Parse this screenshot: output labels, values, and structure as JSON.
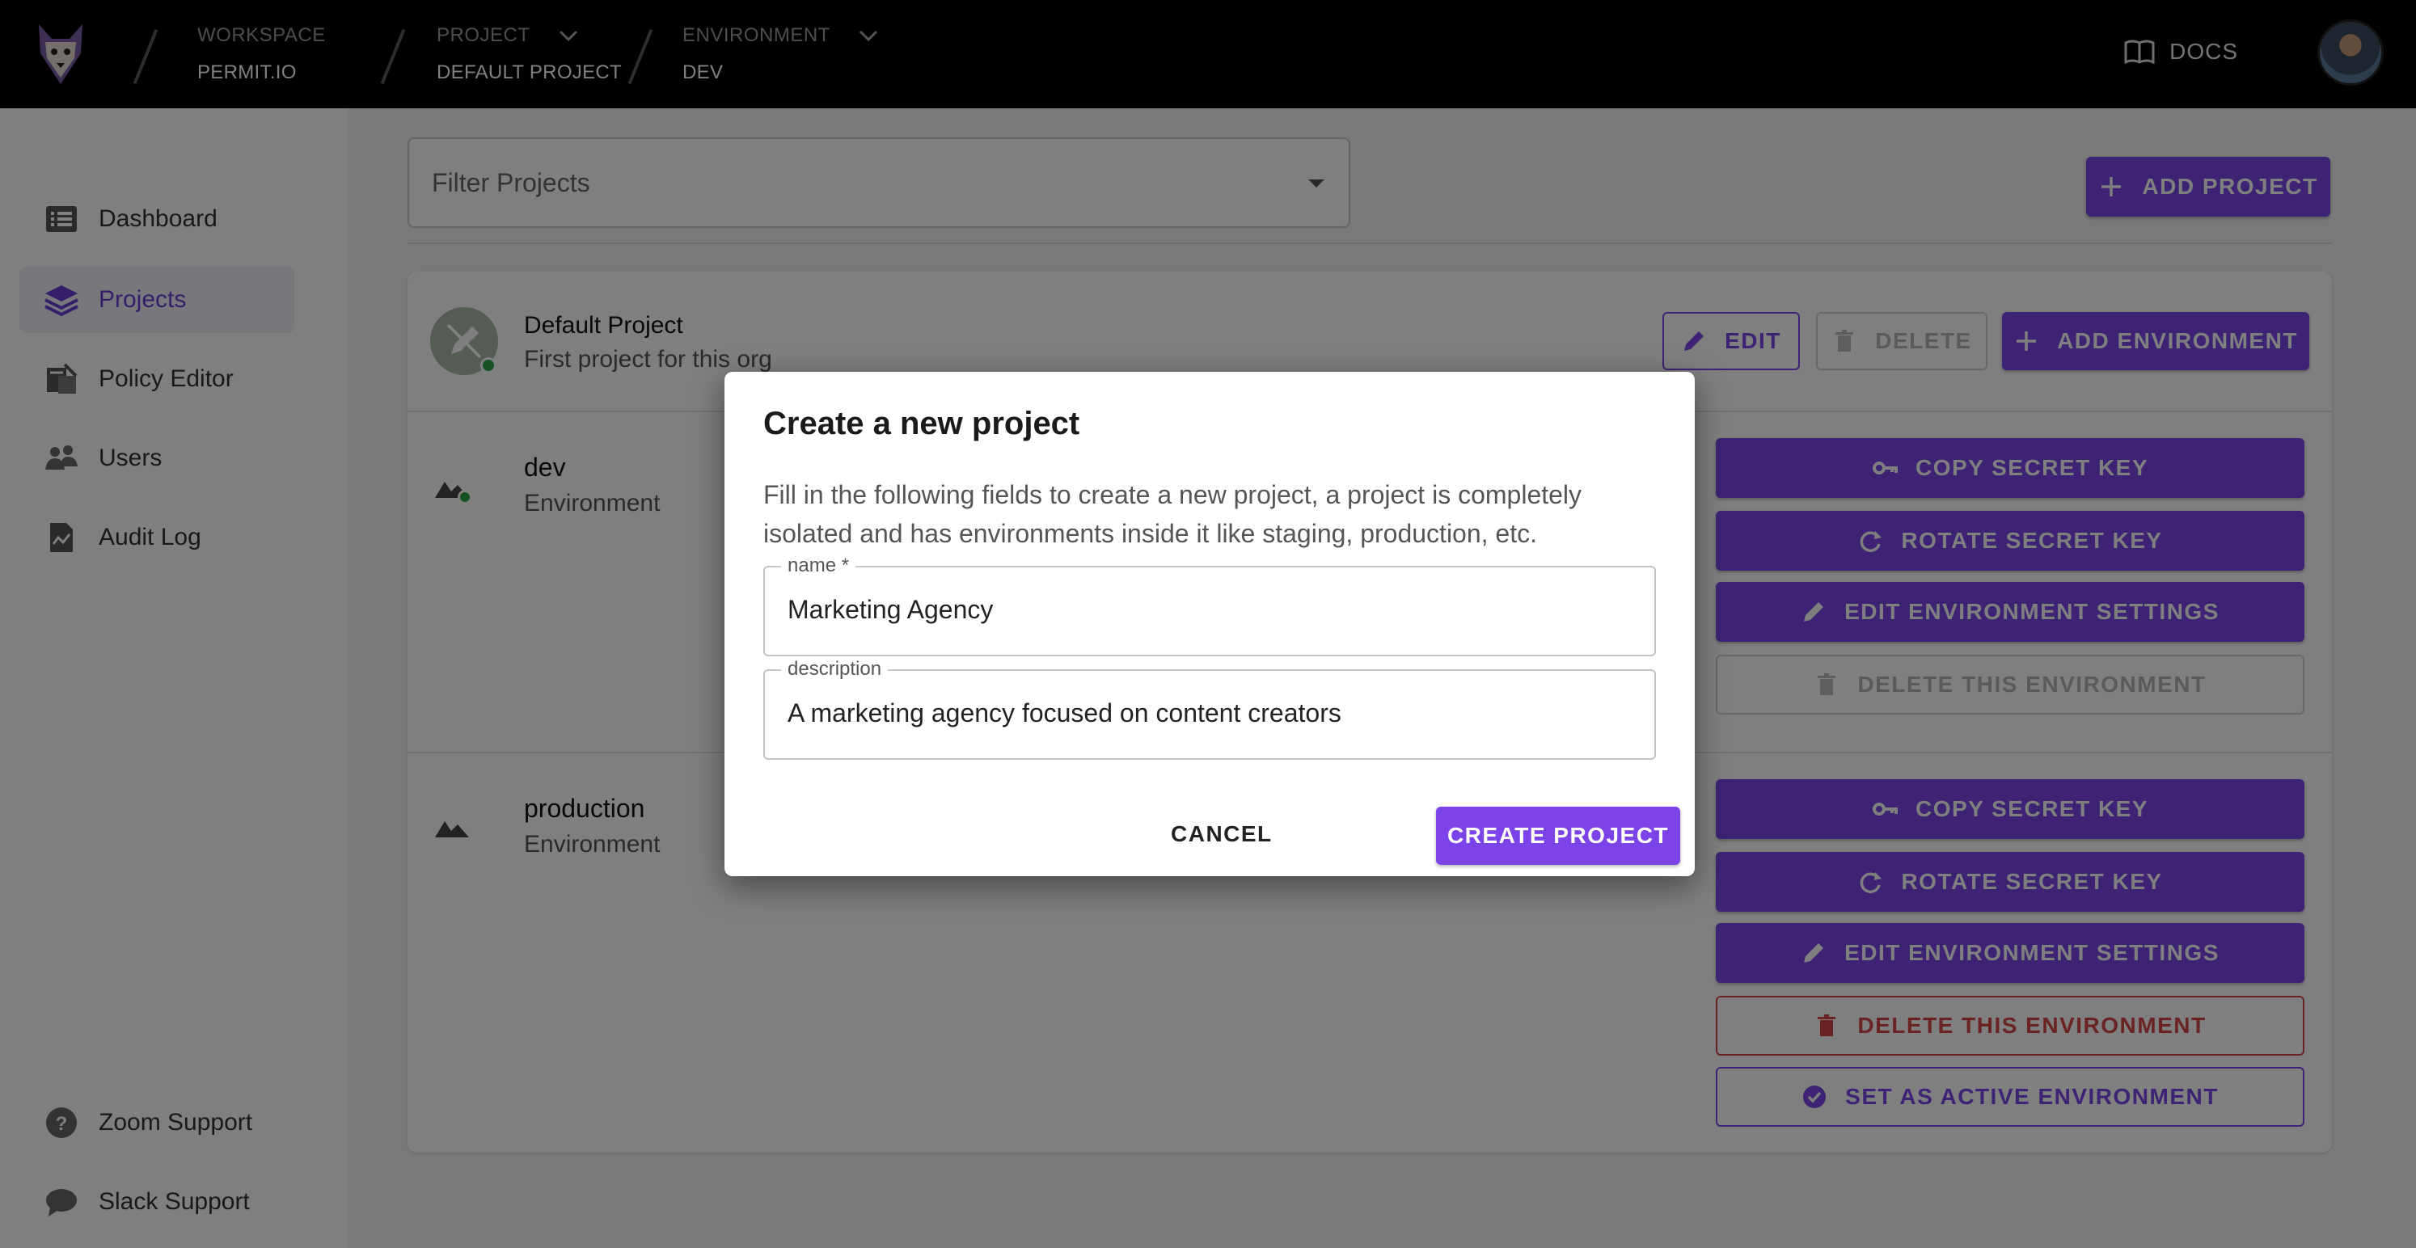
{
  "topbar": {
    "workspace_label": "WORKSPACE",
    "workspace_value": "PERMIT.IO",
    "project_label": "PROJECT",
    "project_value": "DEFAULT PROJECT",
    "environment_label": "ENVIRONMENT",
    "environment_value": "DEV",
    "docs_label": "DOCS"
  },
  "sidebar": {
    "items": [
      {
        "label": "Dashboard",
        "icon": "list-icon"
      },
      {
        "label": "Projects",
        "icon": "layers-icon",
        "active": true
      },
      {
        "label": "Policy Editor",
        "icon": "policy-icon"
      },
      {
        "label": "Users",
        "icon": "users-icon"
      },
      {
        "label": "Audit Log",
        "icon": "audit-icon"
      }
    ],
    "footer": [
      {
        "label": "Zoom Support",
        "icon": "help-icon"
      },
      {
        "label": "Slack Support",
        "icon": "chat-icon"
      }
    ]
  },
  "main": {
    "filter_placeholder": "Filter Projects",
    "add_project_label": "ADD PROJECT",
    "project": {
      "name": "Default Project",
      "description": "First project for this org",
      "edit_label": "EDIT",
      "delete_label": "DELETE",
      "add_environment_label": "ADD ENVIRONMENT"
    },
    "environments": [
      {
        "name": "dev",
        "type": "Environment",
        "copy_key": "COPY SECRET KEY",
        "rotate_key": "ROTATE SECRET KEY",
        "edit_settings": "EDIT ENVIRONMENT SETTINGS",
        "delete": "DELETE THIS ENVIRONMENT"
      },
      {
        "name": "production",
        "type": "Environment",
        "copy_key": "COPY SECRET KEY",
        "rotate_key": "ROTATE SECRET KEY",
        "edit_settings": "EDIT ENVIRONMENT SETTINGS",
        "delete": "DELETE THIS ENVIRONMENT",
        "set_active": "SET AS ACTIVE ENVIRONMENT"
      }
    ]
  },
  "dialog": {
    "title": "Create a new project",
    "description": "Fill in the following fields to create a new project, a project is completely isolated and has environments inside it like staging, production, etc.",
    "name_label": "name *",
    "name_value": "Marketing Agency",
    "description_label": "description",
    "description_value": "A marketing agency focused on content creators",
    "cancel_label": "CANCEL",
    "create_label": "CREATE PROJECT"
  },
  "colors": {
    "accent": "#7c44e8",
    "danger": "#d54646",
    "status_green": "#2ea043",
    "topbar": "#000000"
  }
}
